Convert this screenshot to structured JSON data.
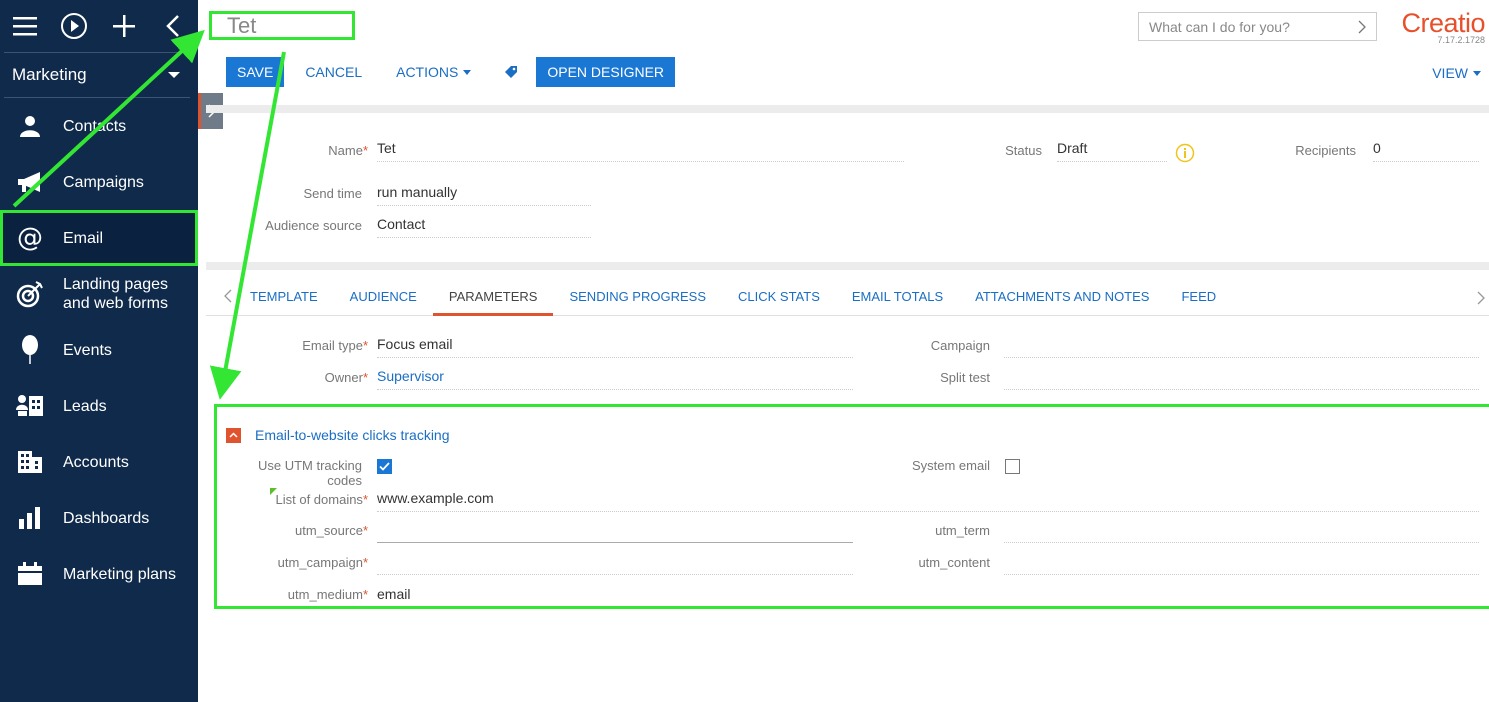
{
  "sidebar": {
    "workspace": "Marketing",
    "items": [
      {
        "label": "Contacts",
        "icon": "person-icon"
      },
      {
        "label": "Campaigns",
        "icon": "megaphone-icon"
      },
      {
        "label": "Email",
        "icon": "at-sign-icon"
      },
      {
        "label": "Landing pages and web forms",
        "icon": "target-icon"
      },
      {
        "label": "Events",
        "icon": "balloon-icon"
      },
      {
        "label": "Leads",
        "icon": "leads-icon"
      },
      {
        "label": "Accounts",
        "icon": "building-icon"
      },
      {
        "label": "Dashboards",
        "icon": "bar-chart-icon"
      },
      {
        "label": "Marketing plans",
        "icon": "calendar-icon"
      }
    ]
  },
  "header": {
    "title": "Tet",
    "search_placeholder": "What can I do for you?",
    "brand": "Creatio",
    "version": "7.17.2.1728"
  },
  "toolbar": {
    "save": "SAVE",
    "cancel": "CANCEL",
    "actions": "ACTIONS",
    "open_designer": "OPEN DESIGNER",
    "view": "VIEW"
  },
  "summary": {
    "name_label": "Name",
    "name_value": "Tet",
    "send_time_label": "Send time",
    "send_time_value": "run manually",
    "audience_label": "Audience source",
    "audience_value": "Contact",
    "status_label": "Status",
    "status_value": "Draft",
    "recipients_label": "Recipients",
    "recipients_value": "0"
  },
  "tabs": [
    "TEMPLATE",
    "AUDIENCE",
    "PARAMETERS",
    "SENDING PROGRESS",
    "CLICK STATS",
    "EMAIL TOTALS",
    "ATTACHMENTS AND NOTES",
    "FEED"
  ],
  "params": {
    "email_type_label": "Email type",
    "email_type_value": "Focus email",
    "owner_label": "Owner",
    "owner_value": "Supervisor",
    "campaign_label": "Campaign",
    "campaign_value": "",
    "split_test_label": "Split test",
    "split_test_value": ""
  },
  "tracking": {
    "group_title": "Email-to-website clicks tracking",
    "use_utm_label": "Use UTM tracking codes",
    "use_utm_checked": true,
    "system_email_label": "System email",
    "system_email_checked": false,
    "domains_label": "List of domains",
    "domains_value": "www.example.com",
    "utm_source_label": "utm_source",
    "utm_source_value": "",
    "utm_campaign_label": "utm_campaign",
    "utm_campaign_value": "",
    "utm_medium_label": "utm_medium",
    "utm_medium_value": "email",
    "utm_term_label": "utm_term",
    "utm_term_value": "",
    "utm_content_label": "utm_content",
    "utm_content_value": ""
  },
  "colors": {
    "sidebar_bg": "#0f2a4a",
    "accent_blue": "#1a77d3",
    "brand_orange": "#e8502c",
    "highlight_green": "#33e633"
  }
}
